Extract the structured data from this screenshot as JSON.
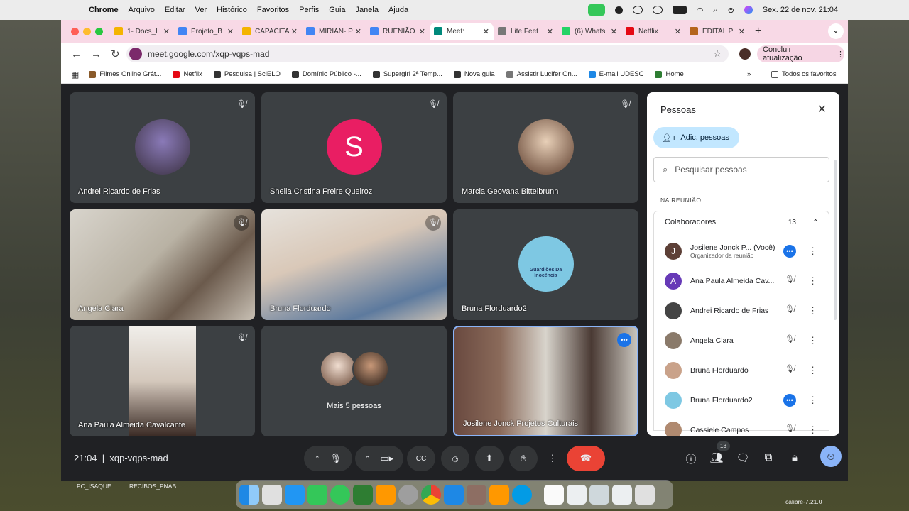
{
  "menubar": {
    "app": "Chrome",
    "items": [
      "Arquivo",
      "Editar",
      "Ver",
      "Histórico",
      "Favoritos",
      "Perfis",
      "Guia",
      "Janela",
      "Ajuda"
    ],
    "datetime": "Sex. 22 de nov.  21:04"
  },
  "tabs": [
    {
      "label": "1- Docs_I",
      "color": "#f4b400"
    },
    {
      "label": "Projeto_B",
      "color": "#4285f4"
    },
    {
      "label": "CAPACITA",
      "color": "#f4b400"
    },
    {
      "label": "MIRIAN- P",
      "color": "#4285f4"
    },
    {
      "label": "RUENIÃO",
      "color": "#4285f4"
    },
    {
      "label": "Meet:",
      "color": "#00897b",
      "active": true
    },
    {
      "label": "Lite Feet",
      "color": "#777"
    },
    {
      "label": "(6) Whats",
      "color": "#25d366"
    },
    {
      "label": "Netflix",
      "color": "#e50914"
    },
    {
      "label": "EDITAL P",
      "color": "#b5651d"
    }
  ],
  "url": "meet.google.com/xqp-vqps-mad",
  "update_label": "Concluir atualização",
  "bookmarks": [
    "Filmes Online Grát...",
    "Netflix",
    "Pesquisa | SciELO",
    "Domínio Público -...",
    "Supergirl 2ª Temp...",
    "Nova guia",
    "Assistir Lucifer On...",
    "E-mail UDESC",
    "Home"
  ],
  "all_favorites": "Todos os favoritos",
  "tiles": [
    {
      "name": "Andrei Ricardo de Frias"
    },
    {
      "name": "Sheila Cristina Freire Queiroz",
      "initial": "S"
    },
    {
      "name": "Marcia Geovana Bittelbrunn"
    },
    {
      "name": "Angela Clara"
    },
    {
      "name": "Bruna Florduardo"
    },
    {
      "name": "Bruna Florduardo2",
      "logo": "Guardiões Da Inocência"
    },
    {
      "name": "Ana Paula Almeida Cavalcante"
    },
    {
      "name": "Mais 5 pessoas"
    },
    {
      "name": "Josilene Jonck Projetos Culturais"
    }
  ],
  "people": {
    "title": "Pessoas",
    "add": "Adic. pessoas",
    "search_placeholder": "Pesquisar pessoas",
    "section": "NA REUNIÃO",
    "group": "Colaboradores",
    "count": "13",
    "list": [
      {
        "name": "Josilene Jonck P...  (Você)",
        "sub": "Organizador da reunião",
        "initial": "J",
        "color": "#5d4037"
      },
      {
        "name": "Ana Paula Almeida Cav...",
        "initial": "A",
        "color": "#673ab7"
      },
      {
        "name": "Andrei Ricardo de Frias",
        "color": "#444"
      },
      {
        "name": "Angela Clara",
        "color": "#8a7a6a"
      },
      {
        "name": "Bruna Florduardo",
        "color": "#c9a28a"
      },
      {
        "name": "Bruna Florduardo2",
        "color": "#7ec8e3"
      },
      {
        "name": "Cassiele Campos",
        "color": "#b08a70"
      }
    ]
  },
  "bottom": {
    "time": "21:04",
    "code": "xqp-vqps-mad",
    "people_badge": "13"
  },
  "desktop": {
    "folder1": "PC_ISAQUE",
    "folder2": "RECIBOS_PNAB",
    "app": "calibre-7.21.0"
  }
}
